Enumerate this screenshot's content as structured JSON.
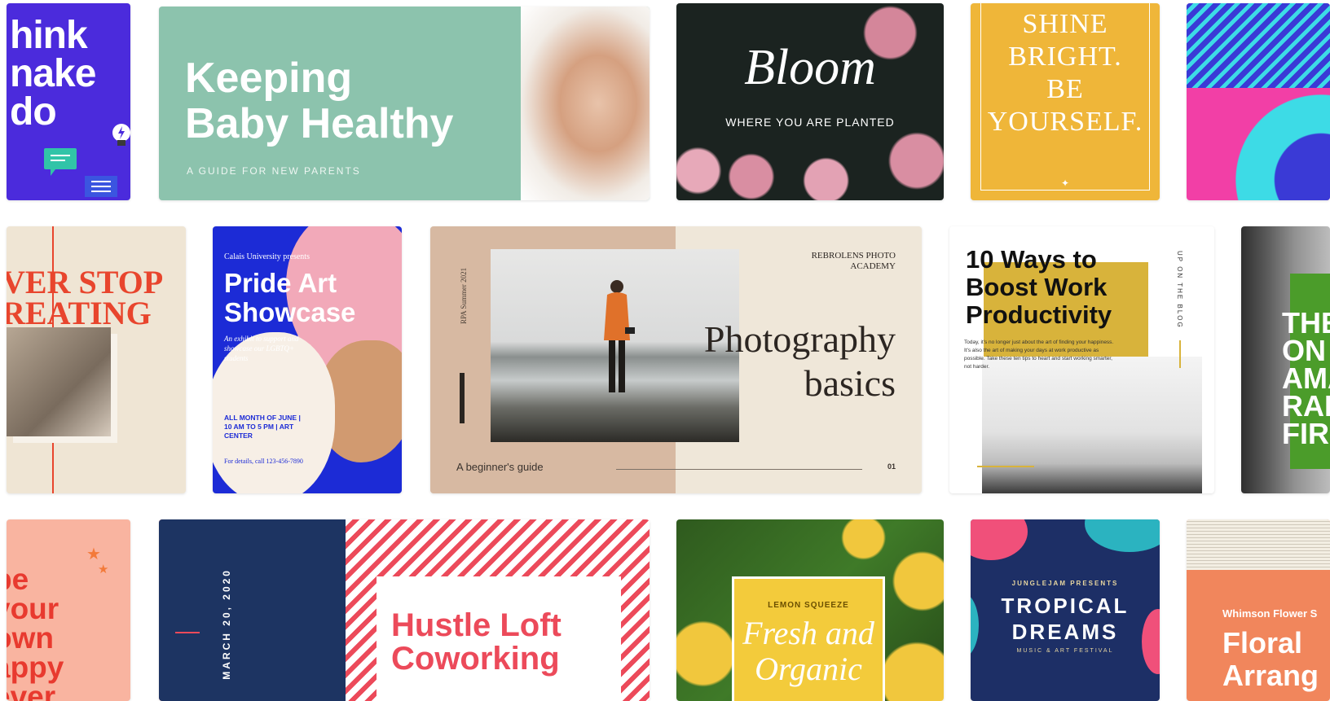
{
  "templates": {
    "think": {
      "text": "hink\nnake\ndo"
    },
    "baby": {
      "title": "Keeping\nBaby Healthy",
      "subtitle": "A GUIDE FOR NEW PARENTS"
    },
    "bloom": {
      "title": "Bloom",
      "subtitle": "WHERE YOU ARE PLANTED"
    },
    "shine": {
      "text": "SHINE\nBRIGHT.\nBE\nYOURSELF.",
      "star": "✦"
    },
    "never": {
      "text": "VER STOP\nREATING"
    },
    "pride": {
      "presenter": "Calais University presents",
      "title": "Pride Art\nShowcase",
      "description": "An exhibit to support and showcase our LGBTQ+ students",
      "when": "ALL MONTH OF JUNE | 10 AM TO 5 PM | ART CENTER",
      "info": "For details, call 123-456-7890"
    },
    "photo": {
      "vertical": "RPA Summer 2021",
      "academy": "REBROLENS PHOTO\nACADEMY",
      "title": "Photography\nbasics",
      "guide": "A beginner's guide",
      "page": "01"
    },
    "ways": {
      "title": "10 Ways to\nBoost Work\nProductivity",
      "paragraph": "Today, it's no longer just about the art of finding your happiness. It's also the art of making your days at work productive as possible. Take these ten tips to heart and start working smarter, not harder.",
      "side": "UP ON THE BLOG"
    },
    "rain": {
      "text": "THE\nON T\nAMA\nRAI\nFIR"
    },
    "happy": {
      "text": "be\nyour\nown\nappy\never",
      "star": "★"
    },
    "hustle": {
      "date": "MARCH 20, 2020",
      "title": "Hustle Loft\nCoworking"
    },
    "lemon": {
      "label": "LEMON SQUEEZE",
      "title": "Fresh and\nOrganic"
    },
    "tropical": {
      "presenter": "JUNGLEJAM PRESENTS",
      "title": "TROPICAL\nDREAMS",
      "subtitle": "MUSIC & ART FESTIVAL"
    },
    "flower": {
      "presenter": "Whimson Flower S",
      "title": "Floral\nArrang"
    }
  },
  "colors": {
    "baby_bg": "#8cc3ad",
    "think_bg": "#4b2bdc",
    "shine_bg": "#efb639",
    "pride_bg": "#1c2bd6",
    "hustle_navy": "#1d3462",
    "hustle_accent": "#ec4a5a",
    "ways_accent": "#d8b33b",
    "tropical_bg": "#1d2f66"
  },
  "icons": [
    "lightbulb-icon",
    "chat-bubble-icon",
    "menu-icon",
    "star-icon",
    "camera-icon"
  ]
}
